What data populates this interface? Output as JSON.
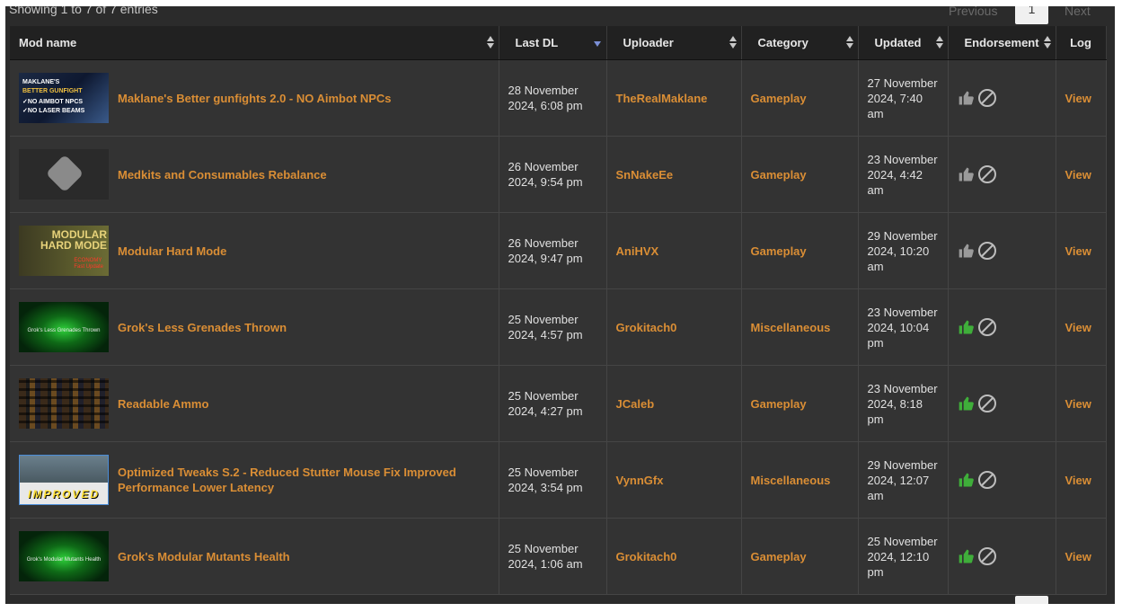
{
  "info_text": "Showing 1 to 7 of 7 entries",
  "pagination": {
    "previous": "Previous",
    "current": "1",
    "next": "Next"
  },
  "columns": [
    "Mod name",
    "Last DL",
    "Uploader",
    "Category",
    "Updated",
    "Endorsement",
    "Log"
  ],
  "thumb_text": {
    "t1": [
      "MAKLANE'S",
      "BETTER GUNFIGHT",
      "✓NO AIMBOT NPCS",
      "✓NO LASER BEAMS"
    ],
    "t3a": "MODULAR",
    "t3b": "HARD MODE",
    "t3c": "ECONOMY",
    "t3d": "Fast Update",
    "t4": "Grok's Less Grenades Thrown",
    "t6": "IMPROVED",
    "t7": "Grok's Modular Mutants Health"
  },
  "rows": [
    {
      "name": "Maklane's Better gunfights 2.0 - NO Aimbot NPCs",
      "last_dl": "28 November 2024, 6:08 pm",
      "uploader": "TheRealMaklane",
      "category": "Gameplay",
      "updated": "27 November 2024, 7:40 am",
      "endorsed": false,
      "log": "View"
    },
    {
      "name": "Medkits and Consumables Rebalance",
      "last_dl": "26 November 2024, 9:54 pm",
      "uploader": "SnNakeEe",
      "category": "Gameplay",
      "updated": "23 November 2024, 4:42 am",
      "endorsed": false,
      "log": "View"
    },
    {
      "name": "Modular Hard Mode",
      "last_dl": "26 November 2024, 9:47 pm",
      "uploader": "AniHVX",
      "category": "Gameplay",
      "updated": "29 November 2024, 10:20 am",
      "endorsed": false,
      "log": "View"
    },
    {
      "name": "Grok's Less Grenades Thrown",
      "last_dl": "25 November 2024, 4:57 pm",
      "uploader": "Grokitach0",
      "category": "Miscellaneous",
      "updated": "23 November 2024, 10:04 pm",
      "endorsed": true,
      "log": "View"
    },
    {
      "name": "Readable Ammo",
      "last_dl": "25 November 2024, 4:27 pm",
      "uploader": "JCaleb",
      "category": "Gameplay",
      "updated": "23 November 2024, 8:18 pm",
      "endorsed": true,
      "log": "View"
    },
    {
      "name": "Optimized Tweaks S.2 - Reduced Stutter Mouse Fix Improved Performance Lower Latency",
      "last_dl": "25 November 2024, 3:54 pm",
      "uploader": "VynnGfx",
      "category": "Miscellaneous",
      "updated": "29 November 2024, 12:07 am",
      "endorsed": true,
      "log": "View"
    },
    {
      "name": "Grok's Modular Mutants Health",
      "last_dl": "25 November 2024, 1:06 am",
      "uploader": "Grokitach0",
      "category": "Gameplay",
      "updated": "25 November 2024, 12:10 pm",
      "endorsed": true,
      "log": "View"
    }
  ],
  "colors": {
    "link": "#da8e35",
    "endorsed": "#3fae3a",
    "not_endorsed": "#9a9a9a",
    "header_bg": "#212121",
    "row_bg": "#333333"
  },
  "icons": {
    "endorse": "thumbs-up-icon",
    "abstain": "ban-icon"
  }
}
